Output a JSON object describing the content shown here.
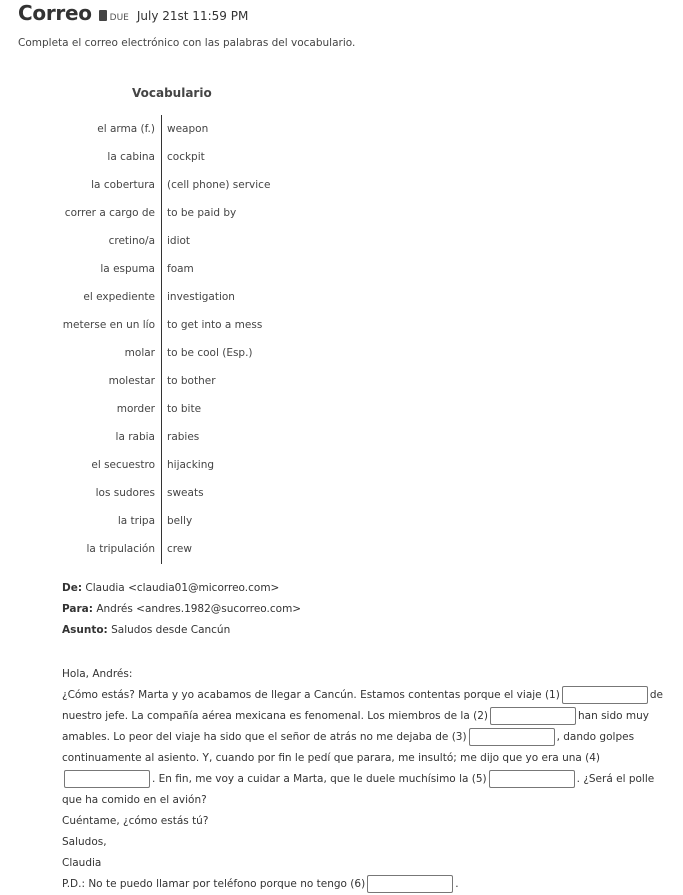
{
  "header": {
    "title": "Correo",
    "due_icon": "book-icon",
    "due_label": "DUE",
    "due_date": "July 21st 11:59 PM"
  },
  "instructions": "Completa el correo electrónico con las palabras del vocabulario.",
  "vocabulario": {
    "title": "Vocabulario",
    "items": [
      {
        "es": "el arma (f.)",
        "en": "weapon"
      },
      {
        "es": "la cabina",
        "en": "cockpit"
      },
      {
        "es": "la cobertura",
        "en": "(cell phone) service"
      },
      {
        "es": "correr a cargo de",
        "en": "to be paid by"
      },
      {
        "es": "cretino/a",
        "en": "idiot"
      },
      {
        "es": "la espuma",
        "en": "foam"
      },
      {
        "es": "el expediente",
        "en": "investigation"
      },
      {
        "es": "meterse en un lío",
        "en": "to get into a mess"
      },
      {
        "es": "molar",
        "en": "to be cool (Esp.)"
      },
      {
        "es": "molestar",
        "en": "to bother"
      },
      {
        "es": "morder",
        "en": "to bite"
      },
      {
        "es": "la rabia",
        "en": "rabies"
      },
      {
        "es": "el secuestro",
        "en": "hijacking"
      },
      {
        "es": "los sudores",
        "en": "sweats"
      },
      {
        "es": "la tripa",
        "en": "belly"
      },
      {
        "es": "la tripulación",
        "en": "crew"
      }
    ]
  },
  "email": {
    "from_label": "De:",
    "from_value": "Claudia <claudia01@micorreo.com>",
    "to_label": "Para:",
    "to_value": "Andrés <andres.1982@sucorreo.com>",
    "subject_label": "Asunto:",
    "subject_value": "Saludos desde Cancún",
    "greeting": "Hola, Andrés:",
    "seg1": "¿Cómo estás? Marta y yo acabamos de llegar a Cancún. Estamos contentas porque el viaje (1)",
    "seg2": "de nuestro jefe. La compañía aérea mexicana es fenomenal. Los miembros de la (2)",
    "seg3": "han sido muy amables. Lo peor del viaje ha sido que el señor de atrás no me dejaba de (3)",
    "seg4": ", dando golpes continuamente al asiento. Y, cuando por fin le pedí que parara, me insultó; me dijo que yo era una (4)",
    "seg5": ". En fin, me voy a cuidar a Marta, que le duele muchísimo la (5)",
    "seg6": ". ¿Será el polle que ha comido en el avión?",
    "line_ask": "Cuéntame, ¿cómo estás tú?",
    "closing": "Saludos,",
    "signature": "Claudia",
    "ps_text": "P.D.: No te puedo llamar por teléfono porque no tengo (6)",
    "ps_end": ".",
    "blanks": [
      "",
      "",
      "",
      "",
      "",
      ""
    ]
  }
}
